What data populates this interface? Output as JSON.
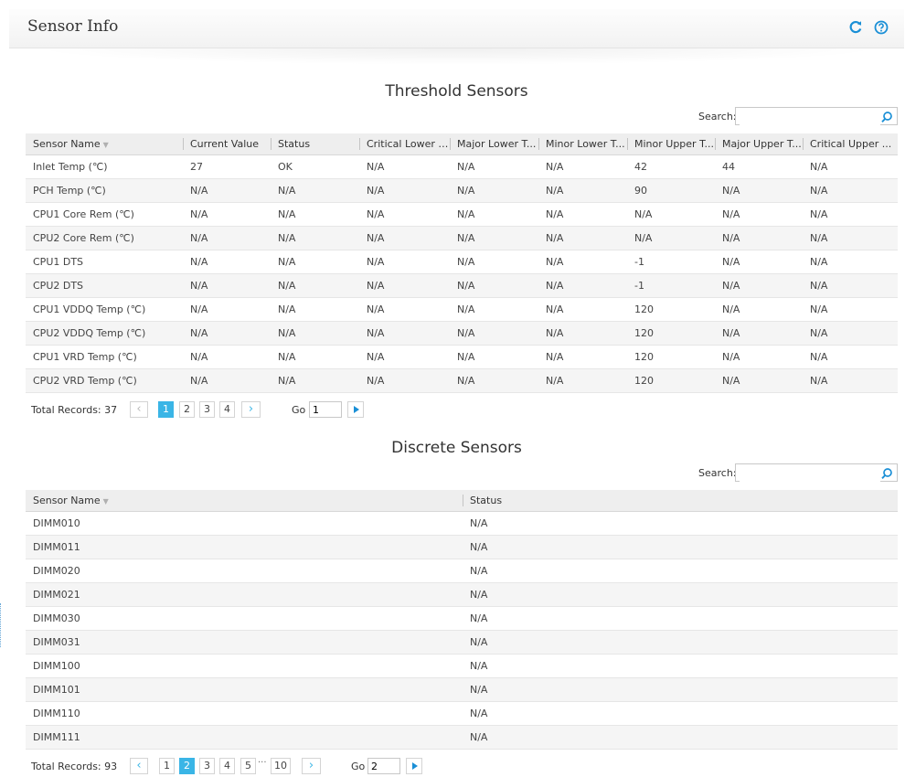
{
  "header": {
    "title": "Sensor Info",
    "refresh_icon": "refresh-icon",
    "help_icon": "help-icon",
    "accent_color": "#1a8fd6"
  },
  "threshold": {
    "title": "Threshold Sensors",
    "search_label": "Search:",
    "search_value": "",
    "columns": [
      "Sensor Name",
      "Current Value",
      "Status",
      "Critical Lower T...",
      "Major Lower T...",
      "Minor Lower T...",
      "Minor Upper T...",
      "Major Upper T...",
      "Critical Upper ..."
    ],
    "rows": [
      [
        "Inlet Temp (℃)",
        "27",
        "OK",
        "N/A",
        "N/A",
        "N/A",
        "42",
        "44",
        "N/A"
      ],
      [
        "PCH Temp (℃)",
        "N/A",
        "N/A",
        "N/A",
        "N/A",
        "N/A",
        "90",
        "N/A",
        "N/A"
      ],
      [
        "CPU1 Core Rem (℃)",
        "N/A",
        "N/A",
        "N/A",
        "N/A",
        "N/A",
        "N/A",
        "N/A",
        "N/A"
      ],
      [
        "CPU2 Core Rem (℃)",
        "N/A",
        "N/A",
        "N/A",
        "N/A",
        "N/A",
        "N/A",
        "N/A",
        "N/A"
      ],
      [
        "CPU1 DTS",
        "N/A",
        "N/A",
        "N/A",
        "N/A",
        "N/A",
        "-1",
        "N/A",
        "N/A"
      ],
      [
        "CPU2 DTS",
        "N/A",
        "N/A",
        "N/A",
        "N/A",
        "N/A",
        "-1",
        "N/A",
        "N/A"
      ],
      [
        "CPU1 VDDQ Temp (℃)",
        "N/A",
        "N/A",
        "N/A",
        "N/A",
        "N/A",
        "120",
        "N/A",
        "N/A"
      ],
      [
        "CPU2 VDDQ Temp (℃)",
        "N/A",
        "N/A",
        "N/A",
        "N/A",
        "N/A",
        "120",
        "N/A",
        "N/A"
      ],
      [
        "CPU1 VRD Temp (℃)",
        "N/A",
        "N/A",
        "N/A",
        "N/A",
        "N/A",
        "120",
        "N/A",
        "N/A"
      ],
      [
        "CPU2 VRD Temp (℃)",
        "N/A",
        "N/A",
        "N/A",
        "N/A",
        "N/A",
        "120",
        "N/A",
        "N/A"
      ]
    ],
    "pager": {
      "total_label": "Total Records: 37",
      "pages": [
        "1",
        "2",
        "3",
        "4"
      ],
      "active_page": "1",
      "go_label": "Go",
      "go_value": "1"
    }
  },
  "discrete": {
    "title": "Discrete Sensors",
    "search_label": "Search:",
    "search_value": "",
    "columns": [
      "Sensor Name",
      "Status"
    ],
    "rows": [
      [
        "DIMM010",
        "N/A"
      ],
      [
        "DIMM011",
        "N/A"
      ],
      [
        "DIMM020",
        "N/A"
      ],
      [
        "DIMM021",
        "N/A"
      ],
      [
        "DIMM030",
        "N/A"
      ],
      [
        "DIMM031",
        "N/A"
      ],
      [
        "DIMM100",
        "N/A"
      ],
      [
        "DIMM101",
        "N/A"
      ],
      [
        "DIMM110",
        "N/A"
      ],
      [
        "DIMM111",
        "N/A"
      ]
    ],
    "pager": {
      "total_label": "Total Records: 93",
      "pages": [
        "1",
        "2",
        "3",
        "4",
        "5",
        "10"
      ],
      "ellipsis": "···",
      "active_page": "2",
      "go_label": "Go",
      "go_value": "2"
    }
  }
}
